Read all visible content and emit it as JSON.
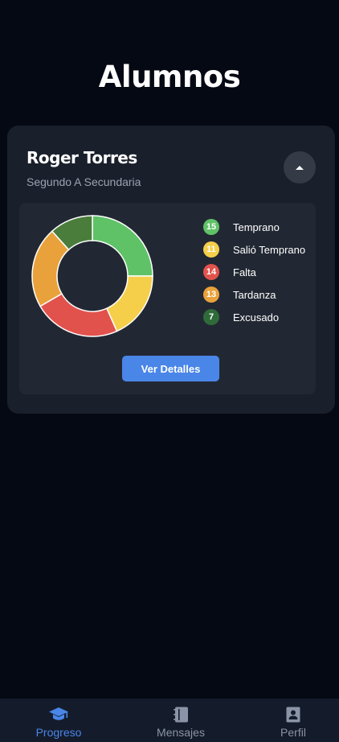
{
  "page": {
    "title": "Alumnos"
  },
  "student": {
    "name": "Roger Torres",
    "grade": "Segundo A Secundaria"
  },
  "chart_data": {
    "type": "pie",
    "categories": [
      "Temprano",
      "Salió Temprano",
      "Falta",
      "Tardanza",
      "Excusado"
    ],
    "values": [
      15,
      11,
      14,
      13,
      7
    ],
    "colors": [
      "#5fc267",
      "#f5cf4a",
      "#e2524c",
      "#e9a23b",
      "#4a7d3c"
    ],
    "title": ""
  },
  "legend": [
    {
      "count": "15",
      "label": "Temprano",
      "color": "#5fc267"
    },
    {
      "count": "11",
      "label": "Salió Temprano",
      "color": "#f5cf4a"
    },
    {
      "count": "14",
      "label": "Falta",
      "color": "#e2524c"
    },
    {
      "count": "13",
      "label": "Tardanza",
      "color": "#e9a23b"
    },
    {
      "count": "7",
      "label": "Excusado",
      "color": "#2f6b3a"
    }
  ],
  "actions": {
    "details_label": "Ver Detalles",
    "collapse_icon": "chevron-up-icon"
  },
  "tabbar": {
    "items": [
      {
        "label": "Progreso",
        "icon": "graduation-cap-icon",
        "active": true
      },
      {
        "label": "Mensajes",
        "icon": "notebook-icon",
        "active": false
      },
      {
        "label": "Perfil",
        "icon": "contact-card-icon",
        "active": false
      }
    ],
    "active_color": "#4a86e8",
    "inactive_color": "#8a94a6"
  }
}
